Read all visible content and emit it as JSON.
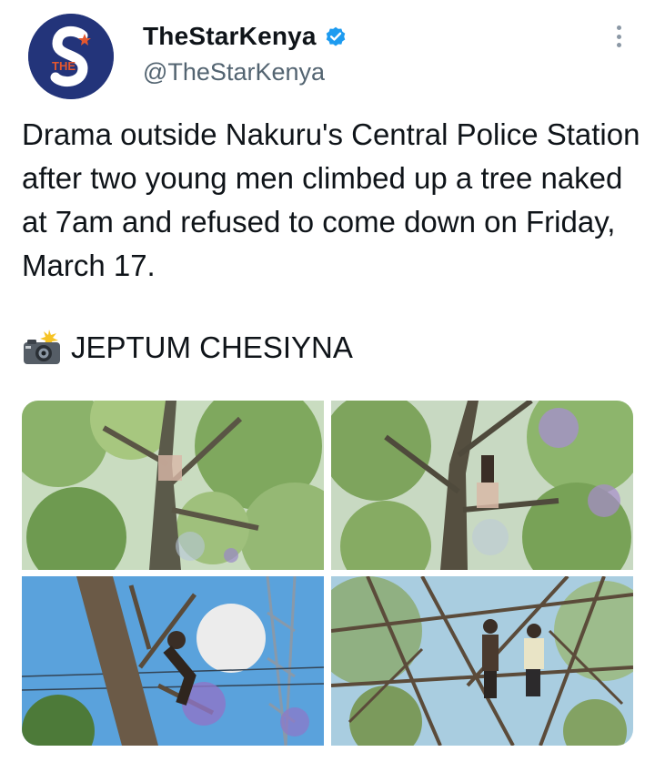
{
  "author": {
    "display_name": "TheStarKenya",
    "handle": "@TheStarKenya",
    "avatar_icon": "the-star-logo",
    "avatar_letters": "THE",
    "verified": true,
    "verified_color": "#1d9bf0"
  },
  "tweet": {
    "text": "Drama outside Nakuru's Central Police Station after two young men climbed up a tree naked at 7am and refused to come down on Friday, March 17.",
    "credit_icon": "camera-flash-icon",
    "credit_text": "JEPTUM CHESIYNA"
  },
  "media": {
    "count": 4,
    "photos": [
      {
        "label": "photo-1",
        "description_icon": "tree-photo"
      },
      {
        "label": "photo-2",
        "description_icon": "tree-photo"
      },
      {
        "label": "photo-3",
        "description_icon": "tree-photo"
      },
      {
        "label": "photo-4",
        "description_icon": "tree-photo"
      }
    ]
  },
  "colors": {
    "brand_navy": "#23347a",
    "text_primary": "#0f1419",
    "text_secondary": "#536471"
  }
}
